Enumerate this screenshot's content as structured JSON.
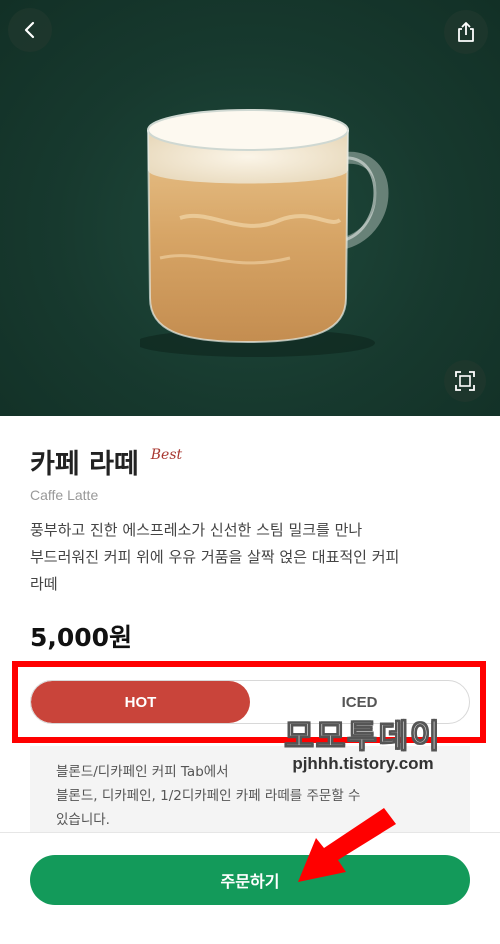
{
  "product": {
    "name_ko": "카페 라떼",
    "badge": "Best",
    "name_en": "Caffe Latte",
    "description_lines": [
      "풍부하고 진한 에스프레소가 신선한 스팀 밀크를 만나",
      "부드러워진 커피 위에 우유 거품을 살짝 얹은 대표적인 커피",
      "라떼"
    ],
    "price": "5,000원"
  },
  "temperature": {
    "options": [
      "HOT",
      "ICED"
    ],
    "selected": "HOT"
  },
  "notice": {
    "lines": [
      "블론드/디카페인 커피 Tab에서",
      "블론드, 디카페인, 1/2디카페인 카페 라떼를 주문할 수",
      "있습니다."
    ]
  },
  "order_button": {
    "label": "주문하기"
  },
  "watermark": {
    "title": "모모투데이",
    "url": "pjhhh.tistory.com"
  },
  "colors": {
    "hero_bg": "#17392e",
    "hot_selected": "#c9443a",
    "order_green": "#139a5a",
    "annotation_red": "#ff0000"
  },
  "icons": [
    "back-icon",
    "share-icon",
    "expand-icon"
  ]
}
